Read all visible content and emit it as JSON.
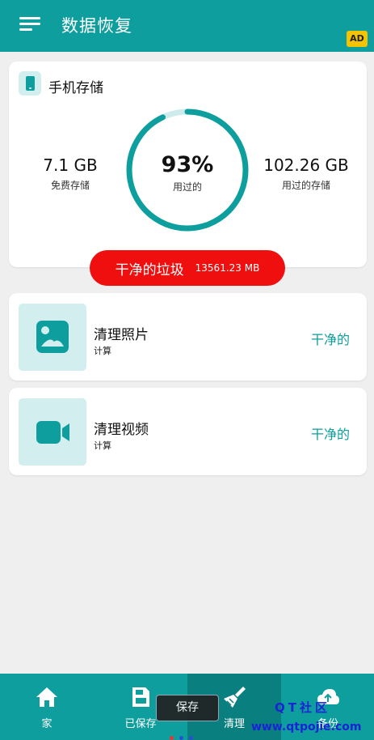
{
  "app_bar": {
    "title": "数据恢复",
    "ad_badge": "AD",
    "menu_icon": "hamburger-menu-icon"
  },
  "storage": {
    "title": "手机存储",
    "free": {
      "value": "7.1 GB",
      "label": "免费存储"
    },
    "used": {
      "value": "102.26 GB",
      "label": "用过的存储"
    },
    "percent_text": "93%",
    "percent_value": 93,
    "percent_label": "用过的",
    "clean_button": {
      "label": "干净的垃圾",
      "size": "13561.23 MB"
    }
  },
  "features": [
    {
      "title": "清理照片",
      "subtitle": "计算",
      "status": "干净的",
      "icon": "image-icon"
    },
    {
      "title": "清理视频",
      "subtitle": "计算",
      "status": "干净的",
      "icon": "video-camera-icon"
    }
  ],
  "bottom_nav": [
    {
      "label": "家",
      "icon": "home-icon",
      "active": false
    },
    {
      "label": "已保存",
      "icon": "save-icon",
      "active": false
    },
    {
      "label": "清理",
      "icon": "broom-icon",
      "active": true
    },
    {
      "label": "备份",
      "icon": "cloud-upload-icon",
      "active": false
    }
  ],
  "toast": {
    "text": "保存"
  },
  "watermark": {
    "title": "QT社区",
    "url": "www.qtpojie.com"
  },
  "colors": {
    "primary": "#0e9e9e",
    "primary_dark": "#0a7f7f",
    "accent_red": "#f00f0f",
    "ring_track": "#cdebeb",
    "icon_bg": "#d2eeee",
    "ad_yellow": "#f5c400",
    "watermark_blue": "#1a24d6"
  }
}
